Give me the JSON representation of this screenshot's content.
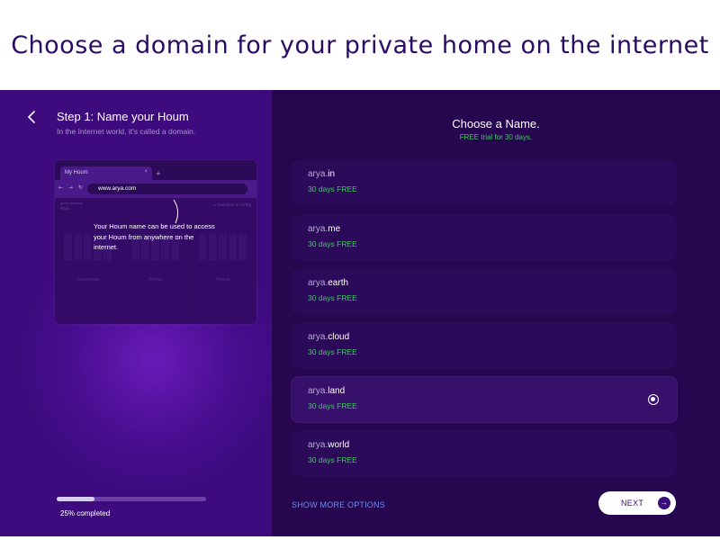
{
  "headline": "Choose a domain for your private home on the internet",
  "left": {
    "step_title": "Step 1: Name your Houm",
    "step_subtitle": "In the Internet world, it's called a domain.",
    "browser_mock": {
      "tab_label": "My Houm",
      "tab_close": "×",
      "new_tab": "+",
      "nav_glyphs": "← → ↻",
      "url": "www.arya.com",
      "greeting": "good morning",
      "user": "Arya",
      "links": "⌂ Overview   ⚙ Config",
      "columns": [
        "Documents",
        "Photos",
        "People"
      ],
      "callout": "Your Houm name can be used to access your Houm from anywhere on the internet."
    },
    "progress": {
      "fraction": 0.25,
      "label": "25% completed"
    }
  },
  "right": {
    "title": "Choose a Name.",
    "subtitle": "FREE trial for 30 days.",
    "options": [
      {
        "prefix": "arya.",
        "tld": "in",
        "tag": "30 days FREE"
      },
      {
        "prefix": "arya.",
        "tld": "me",
        "tag": "30 days FREE"
      },
      {
        "prefix": "arya.",
        "tld": "earth",
        "tag": "30 days FREE"
      },
      {
        "prefix": "arya.",
        "tld": "cloud",
        "tag": "30 days FREE"
      },
      {
        "prefix": "arya.",
        "tld": "land",
        "tag": "30 days FREE"
      },
      {
        "prefix": "arya.",
        "tld": "world",
        "tag": "30 days FREE"
      }
    ],
    "selected_option": "arya.land",
    "show_more": "SHOW MORE OPTIONS",
    "next": "NEXT",
    "next_icon": "arrow-right-icon"
  },
  "colors": {
    "left_panel": "#3d0b7e",
    "right_panel": "#25064f",
    "accent_green": "#46c46a",
    "link_blue": "#6b8df0",
    "headline": "#2a0b66"
  }
}
